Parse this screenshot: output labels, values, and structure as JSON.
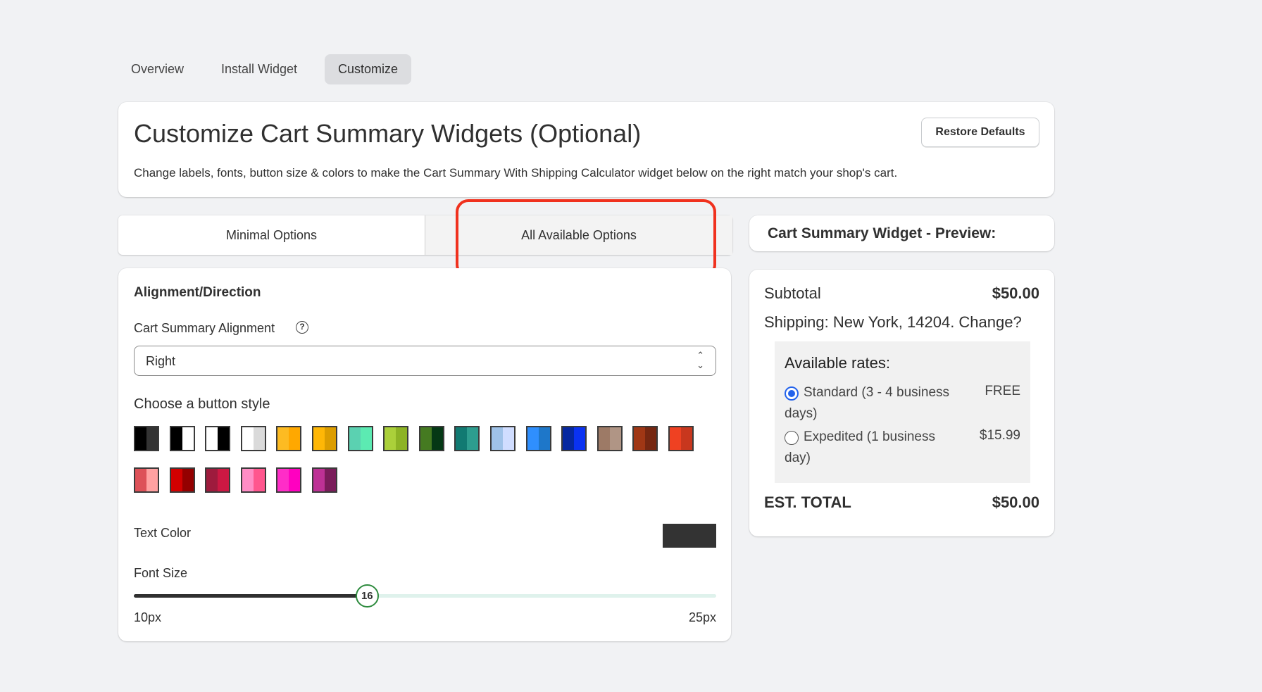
{
  "nav": {
    "tabs": [
      {
        "label": "Overview"
      },
      {
        "label": "Install Widget"
      },
      {
        "label": "Customize"
      }
    ],
    "active": "Customize"
  },
  "header": {
    "title": "Customize Cart Summary Widgets (Optional)",
    "subtitle": "Change labels, fonts, button size & colors to make the Cart Summary With Shipping Calculator widget below on the right match your shop's cart.",
    "restore_label": "Restore Defaults"
  },
  "options_tabs": [
    {
      "label": "Minimal Options"
    },
    {
      "label": "All Available Options"
    }
  ],
  "settings": {
    "section_title": "Alignment/Direction",
    "alignment_label": "Cart Summary Alignment",
    "alignment_value": "Right",
    "button_style_label": "Choose a button style",
    "button_styles": [
      [
        "#000000",
        "#333333"
      ],
      [
        "#000000",
        "#ffffff"
      ],
      [
        "#ffffff",
        "#000000"
      ],
      [
        "#ffffff",
        "#dadada"
      ],
      [
        "#fdbb22",
        "#ffa800"
      ],
      [
        "#ffb706",
        "#dc9d00"
      ],
      [
        "#5bd1b1",
        "#5ceab2"
      ],
      [
        "#abd03a",
        "#8db325"
      ],
      [
        "#457a21",
        "#053815"
      ],
      [
        "#117a72",
        "#2d9d8f"
      ],
      [
        "#9fc2e8",
        "#d0ddff"
      ],
      [
        "#2f8ffe",
        "#1e77c9"
      ],
      [
        "#0628a0",
        "#0a32f2"
      ],
      [
        "#9d7a66",
        "#b09585"
      ],
      [
        "#a03715",
        "#762711"
      ],
      [
        "#ef4122",
        "#c8371e"
      ],
      [
        "#dd5158",
        "#ffa1a1"
      ],
      [
        "#d20000",
        "#940000"
      ],
      [
        "#9e1b3d",
        "#cc1843"
      ],
      [
        "#ff8dc5",
        "#ff568e"
      ],
      [
        "#ff2dc8",
        "#ff00c0"
      ],
      [
        "#bd3195",
        "#7a1c5a"
      ]
    ],
    "text_color_label": "Text Color",
    "text_color": "#333333",
    "font_size_label": "Font Size",
    "font_size": 16,
    "font_min": 10,
    "font_max": 25,
    "font_size_text": "16",
    "font_min_label": "10px",
    "font_max_label": "25px"
  },
  "preview": {
    "header": "Cart Summary Widget - Preview:",
    "subtotal_label": "Subtotal",
    "subtotal_value": "$50.00",
    "shipping": "Shipping: New York, 14204. Change?",
    "rates_title": "Available rates:",
    "rates": [
      {
        "label_line1": "Standard (3 - 4 business",
        "label_line2": "days)",
        "price": "FREE",
        "selected": true
      },
      {
        "label_line1": "Expedited (1 business",
        "label_line2": "day)",
        "price": "$15.99",
        "selected": false
      }
    ],
    "total_label": "EST. TOTAL",
    "total_value": "$50.00"
  },
  "colors": {
    "highlight": "#f0311e",
    "radio": "#2463eb",
    "slider_knob": "#2e8b3e"
  }
}
